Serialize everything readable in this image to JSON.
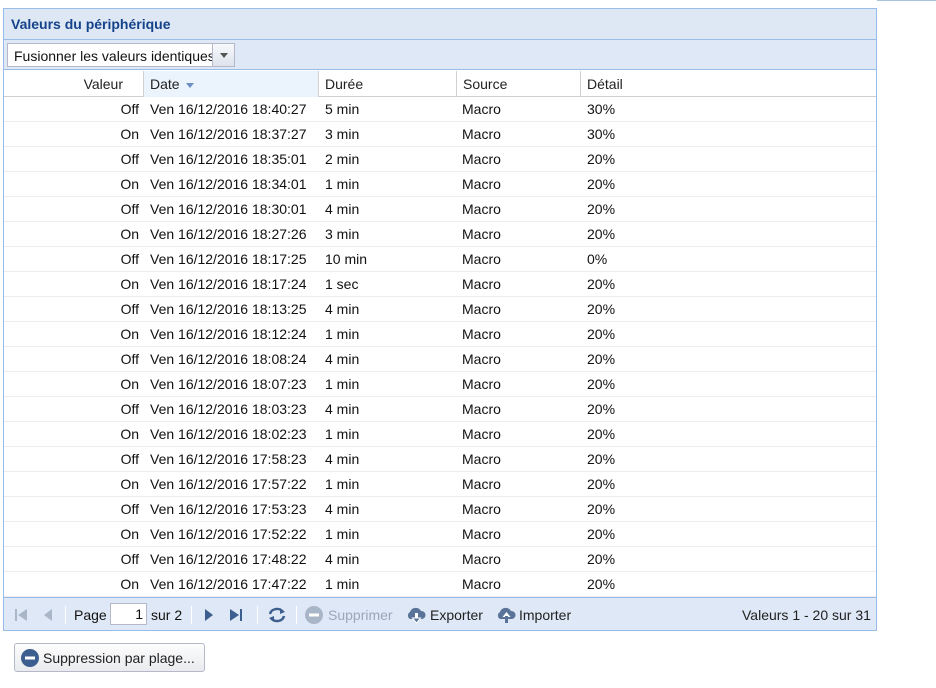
{
  "panel": {
    "title": "Valeurs du périphérique"
  },
  "toolbar": {
    "merge_select": {
      "value": "Fusionner les valeurs identiques"
    }
  },
  "columns": [
    {
      "key": "valeur",
      "label": "Valeur"
    },
    {
      "key": "date",
      "label": "Date",
      "sort": "desc"
    },
    {
      "key": "duree",
      "label": "Durée"
    },
    {
      "key": "source",
      "label": "Source"
    },
    {
      "key": "detail",
      "label": "Détail"
    }
  ],
  "rows": [
    {
      "valeur": "Off",
      "date": "Ven 16/12/2016 18:40:27",
      "duree": "5 min",
      "source": "Macro",
      "detail": "30%"
    },
    {
      "valeur": "On",
      "date": "Ven 16/12/2016 18:37:27",
      "duree": "3 min",
      "source": "Macro",
      "detail": "30%"
    },
    {
      "valeur": "Off",
      "date": "Ven 16/12/2016 18:35:01",
      "duree": "2 min",
      "source": "Macro",
      "detail": "20%"
    },
    {
      "valeur": "On",
      "date": "Ven 16/12/2016 18:34:01",
      "duree": "1 min",
      "source": "Macro",
      "detail": "20%"
    },
    {
      "valeur": "Off",
      "date": "Ven 16/12/2016 18:30:01",
      "duree": "4 min",
      "source": "Macro",
      "detail": "20%"
    },
    {
      "valeur": "On",
      "date": "Ven 16/12/2016 18:27:26",
      "duree": "3 min",
      "source": "Macro",
      "detail": "20%"
    },
    {
      "valeur": "Off",
      "date": "Ven 16/12/2016 18:17:25",
      "duree": "10 min",
      "source": "Macro",
      "detail": "0%"
    },
    {
      "valeur": "On",
      "date": "Ven 16/12/2016 18:17:24",
      "duree": "1 sec",
      "source": "Macro",
      "detail": "20%"
    },
    {
      "valeur": "Off",
      "date": "Ven 16/12/2016 18:13:25",
      "duree": "4 min",
      "source": "Macro",
      "detail": "20%"
    },
    {
      "valeur": "On",
      "date": "Ven 16/12/2016 18:12:24",
      "duree": "1 min",
      "source": "Macro",
      "detail": "20%"
    },
    {
      "valeur": "Off",
      "date": "Ven 16/12/2016 18:08:24",
      "duree": "4 min",
      "source": "Macro",
      "detail": "20%"
    },
    {
      "valeur": "On",
      "date": "Ven 16/12/2016 18:07:23",
      "duree": "1 min",
      "source": "Macro",
      "detail": "20%"
    },
    {
      "valeur": "Off",
      "date": "Ven 16/12/2016 18:03:23",
      "duree": "4 min",
      "source": "Macro",
      "detail": "20%"
    },
    {
      "valeur": "On",
      "date": "Ven 16/12/2016 18:02:23",
      "duree": "1 min",
      "source": "Macro",
      "detail": "20%"
    },
    {
      "valeur": "Off",
      "date": "Ven 16/12/2016 17:58:23",
      "duree": "4 min",
      "source": "Macro",
      "detail": "20%"
    },
    {
      "valeur": "On",
      "date": "Ven 16/12/2016 17:57:22",
      "duree": "1 min",
      "source": "Macro",
      "detail": "20%"
    },
    {
      "valeur": "Off",
      "date": "Ven 16/12/2016 17:53:23",
      "duree": "4 min",
      "source": "Macro",
      "detail": "20%"
    },
    {
      "valeur": "On",
      "date": "Ven 16/12/2016 17:52:22",
      "duree": "1 min",
      "source": "Macro",
      "detail": "20%"
    },
    {
      "valeur": "Off",
      "date": "Ven 16/12/2016 17:48:22",
      "duree": "4 min",
      "source": "Macro",
      "detail": "20%"
    },
    {
      "valeur": "On",
      "date": "Ven 16/12/2016 17:47:22",
      "duree": "1 min",
      "source": "Macro",
      "detail": "20%"
    }
  ],
  "paging": {
    "page_label": "Page",
    "page_value": "1",
    "of_label": "sur 2",
    "delete_label": "Supprimer",
    "export_label": "Exporter",
    "import_label": "Importer",
    "summary": "Valeurs 1 - 20 sur 31"
  },
  "range_delete": {
    "label": "Suppression par plage..."
  },
  "icons": {
    "first": "first-page-icon",
    "prev": "prev-page-icon",
    "next": "next-page-icon",
    "last": "last-page-icon",
    "refresh": "refresh-icon",
    "delete": "minus-circle-icon",
    "export": "cloud-download-icon",
    "import": "cloud-upload-icon"
  },
  "colors": {
    "header_text": "#15428b",
    "toolbar_bg": "#dfe8f6",
    "border": "#99bbe8",
    "icon": "#3d5f8f"
  }
}
